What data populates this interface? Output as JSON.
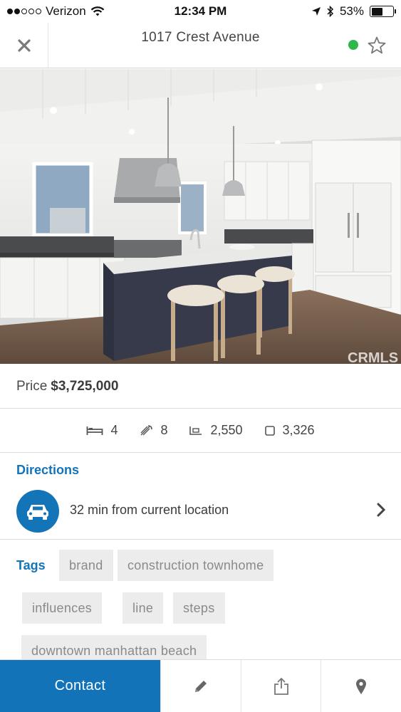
{
  "status_bar": {
    "carrier": "Verizon",
    "time": "12:34 PM",
    "battery": "53%",
    "battery_level": 0.53,
    "signal_bars_filled": 2,
    "signal_bars_total": 5
  },
  "header": {
    "title": "1017 Crest Avenue",
    "status_color": "#2fb84a"
  },
  "photo": {
    "watermark": "CRMLS"
  },
  "price": {
    "label": "Price",
    "value": "$3,725,000"
  },
  "stats": {
    "beds": "4",
    "baths": "8",
    "sqft": "2,550",
    "lot": "3,326"
  },
  "directions": {
    "label": "Directions",
    "text": "32 min from current location"
  },
  "tags": {
    "label": "Tags",
    "items": [
      "brand",
      "construction townhome",
      "influences",
      "line",
      "steps",
      "downtown manhattan beach"
    ]
  },
  "bottom_bar": {
    "contact_label": "Contact"
  },
  "colors": {
    "accent": "#1474b8"
  },
  "icons": [
    "close-icon",
    "star-icon",
    "bed-icon",
    "bath-icon",
    "floor-area-icon",
    "lot-icon",
    "car-icon",
    "chevron-right-icon",
    "pencil-icon",
    "share-icon",
    "location-pin-icon"
  ]
}
